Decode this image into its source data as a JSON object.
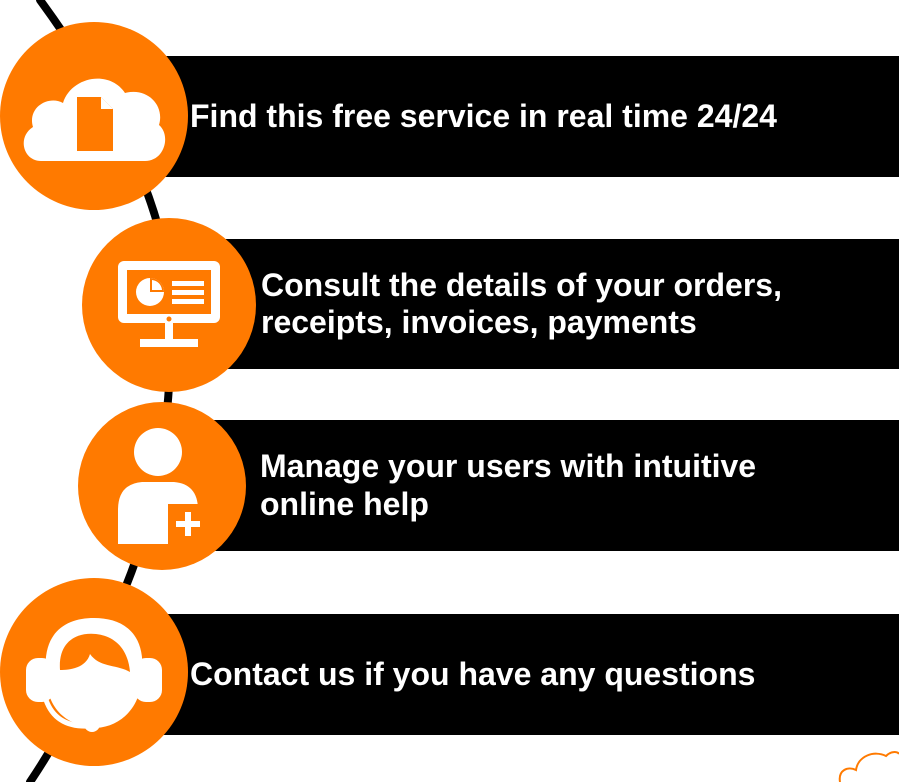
{
  "items": [
    {
      "text": "Find this free service in real time 24/24",
      "icon": "cloud-document-icon"
    },
    {
      "lines": [
        "Consult the details of your orders,",
        "receipts, invoices, payments"
      ],
      "icon": "monitor-chart-icon"
    },
    {
      "lines": [
        "Manage your users with intuitive",
        "online help"
      ],
      "icon": "user-add-icon"
    },
    {
      "text": "Contact us if you have any questions",
      "icon": "headset-icon"
    }
  ],
  "colors": {
    "accent": "#ff7a00",
    "banner": "#000000",
    "text": "#ffffff",
    "line": "#000000"
  }
}
